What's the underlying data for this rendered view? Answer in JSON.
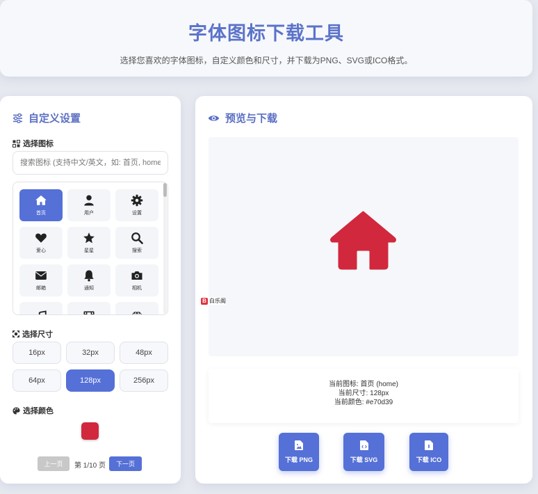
{
  "header": {
    "title": "字体图标下载工具",
    "subtitle": "选择您喜欢的字体图标，自定义颜色和尺寸，并下载为PNG、SVG或ICO格式。"
  },
  "left_panel": {
    "title": "自定义设置",
    "select_icon_label": "选择图标",
    "search_placeholder": "搜索图标 (支持中文/英文，如: 首页, home, u",
    "icons": [
      {
        "label": "首页",
        "icon": "home-icon",
        "active": true
      },
      {
        "label": "用户",
        "icon": "user-icon"
      },
      {
        "label": "设置",
        "icon": "gear-icon"
      },
      {
        "label": "爱心",
        "icon": "heart-icon"
      },
      {
        "label": "星星",
        "icon": "star-icon"
      },
      {
        "label": "搜索",
        "icon": "search-icon"
      },
      {
        "label": "邮箱",
        "icon": "envelope-icon"
      },
      {
        "label": "通知",
        "icon": "bell-icon"
      },
      {
        "label": "相机",
        "icon": "camera-icon"
      },
      {
        "label": "",
        "icon": "music-icon"
      },
      {
        "label": "",
        "icon": "film-icon"
      },
      {
        "label": "",
        "icon": "globe-icon"
      }
    ],
    "select_size_label": "选择尺寸",
    "sizes": [
      "16px",
      "32px",
      "48px",
      "64px",
      "128px",
      "256px"
    ],
    "active_size": "128px",
    "select_color_label": "选择颜色",
    "color_value": "#d1283e",
    "pager": {
      "prev": "上一页",
      "status": "第 1/10 页",
      "next": "下一页"
    }
  },
  "right_panel": {
    "title": "预览与下载",
    "current_icon": "当前图标: 首页 (home)",
    "current_size": "当前尺寸: 128px",
    "current_color": "当前颜色: #e70d39",
    "buttons": {
      "png": "下载 PNG",
      "svg": "下载 SVG",
      "ico": "下载 ICO"
    }
  },
  "watermark": {
    "badge": "B",
    "text": "白乐阁"
  },
  "colors": {
    "accent": "#5570d6",
    "title": "#5b73c9",
    "icon_red": "#d1283e"
  }
}
